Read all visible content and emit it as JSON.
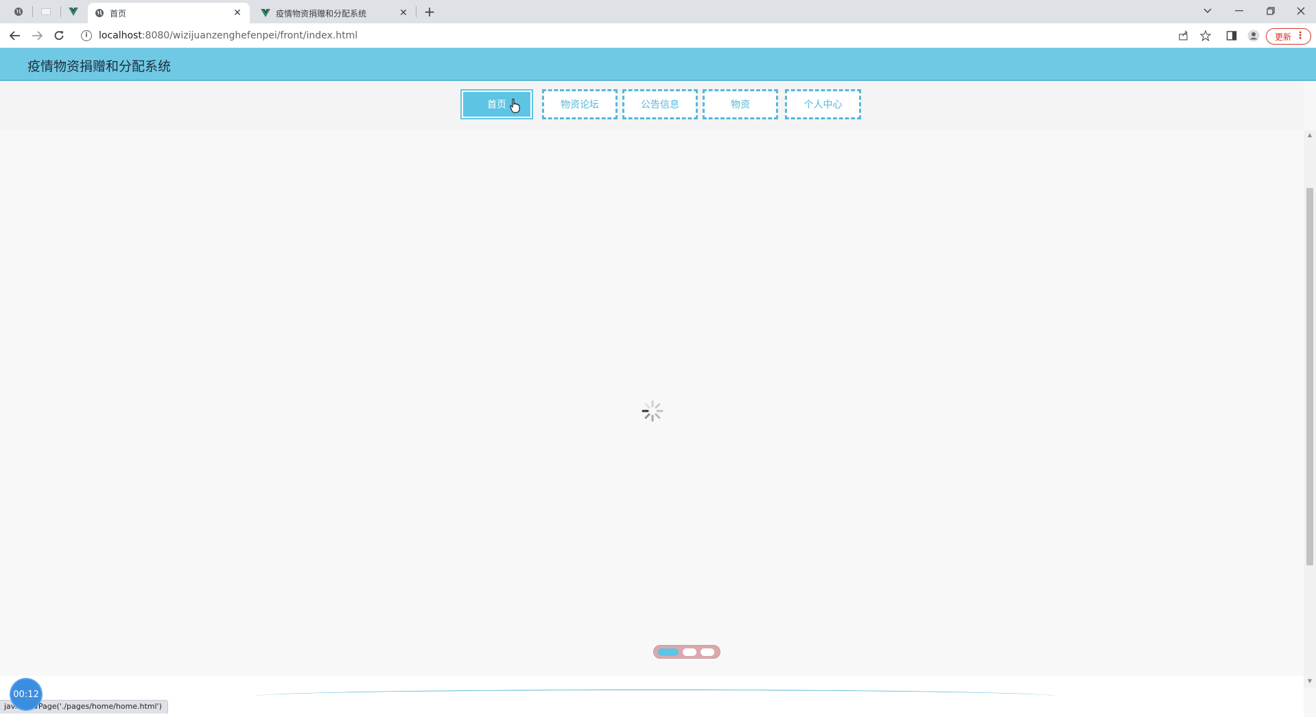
{
  "browser": {
    "tabs": [
      {
        "title": "首页",
        "active": true
      },
      {
        "title": "疫情物资捐赠和分配系统",
        "active": false
      }
    ],
    "close_glyph": "✕",
    "new_tab_glyph": "+",
    "url_host": "localhost",
    "url_rest": ":8080/wizijuanzenghefenpei/front/index.html",
    "update_label": "更新",
    "status_link_text": "jav...:navPage('./pages/home/home.html')",
    "timer": "00:12"
  },
  "site": {
    "title": "疫情物资捐赠和分配系统",
    "menu": [
      {
        "label": "首页",
        "active": true
      },
      {
        "label": "物资论坛",
        "active": false
      },
      {
        "label": "公告信息",
        "active": false
      },
      {
        "label": "物资",
        "active": false
      },
      {
        "label": "个人中心",
        "active": false
      }
    ]
  },
  "carousel": {
    "slides": 3,
    "active_index": 0
  },
  "colors": {
    "accent": "#5ec4e4",
    "header_bg": "#6fc9e5",
    "update_red": "#d93025"
  },
  "icons": {
    "back": "arrow-left-icon",
    "forward": "arrow-right-icon",
    "reload": "reload-icon",
    "info": "info-icon",
    "share": "share-icon",
    "star": "star-icon",
    "sidebar": "sidepanel-icon",
    "profile": "profile-icon",
    "spinner": "loading-spinner-icon",
    "cursor": "hand-cursor-icon"
  }
}
